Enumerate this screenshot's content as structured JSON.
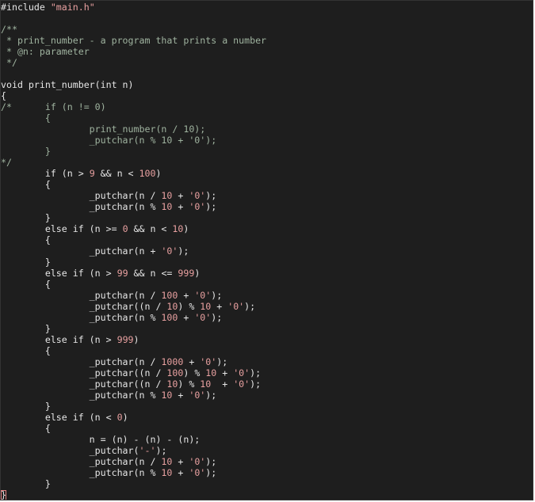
{
  "colors": {
    "background": "#1e1e1e",
    "text": "#e6e6e6",
    "comment": "#9fb39f",
    "string": "#e8a0a0",
    "cursor": "#e08080"
  },
  "editor": {
    "lines": [
      "#include \"main.h\"",
      "",
      "/**",
      " * print_number - a program that prints a number",
      " * @n: parameter",
      " */",
      "",
      "void print_number(int n)",
      "{",
      "/*      if (n != 0)",
      "        {",
      "                print_number(n / 10);",
      "                _putchar(n % 10 + '0');",
      "        }",
      "*/",
      "        if (n > 9 && n < 100)",
      "        {",
      "                _putchar(n / 10 + '0');",
      "                _putchar(n % 10 + '0');",
      "        }",
      "        else if (n >= 0 && n < 10)",
      "        {",
      "                _putchar(n + '0');",
      "        }",
      "        else if (n > 99 && n <= 999)",
      "        {",
      "                _putchar(n / 100 + '0');",
      "                _putchar((n / 10) % 10 + '0');",
      "                _putchar(n % 100 + '0');",
      "        }",
      "        else if (n > 999)",
      "        {",
      "                _putchar(n / 1000 + '0');",
      "                _putchar((n / 100) % 10 + '0');",
      "                _putchar((n / 10) % 10  + '0');",
      "                _putchar(n % 10 + '0');",
      "        }",
      "        else if (n < 0)",
      "        {",
      "                n = (n) - (n) - (n);",
      "                _putchar('-');",
      "                _putchar(n / 10 + '0');",
      "                _putchar(n % 10 + '0');",
      "        }",
      "}"
    ],
    "cursor_line": 44
  }
}
